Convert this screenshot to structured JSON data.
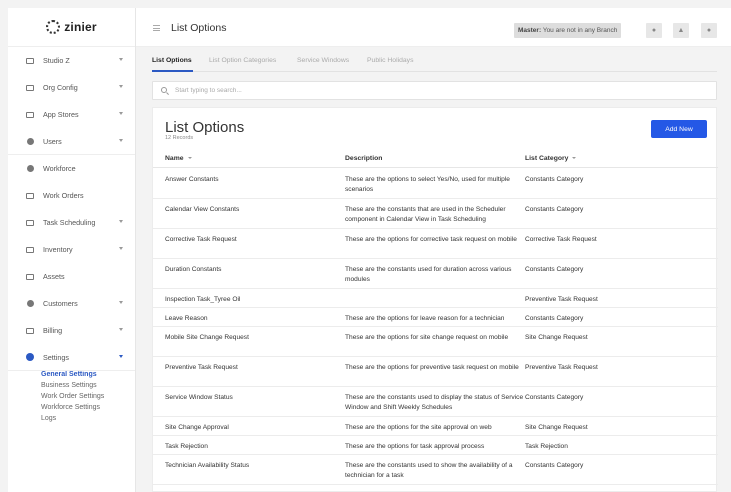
{
  "app": {
    "logo_text": "zinier",
    "page_title": "List Options"
  },
  "sidebar": {
    "items": [
      {
        "label": "Studio Z",
        "icon": "studio-icon",
        "caret": true
      },
      {
        "label": "Org Config",
        "icon": "org-config-icon",
        "caret": true
      },
      {
        "label": "App Stores",
        "icon": "store-icon",
        "caret": true
      },
      {
        "label": "Users",
        "icon": "users-icon",
        "caret": true
      },
      {
        "label": "Workforce",
        "icon": "workforce-icon",
        "caret": false
      },
      {
        "label": "Work Orders",
        "icon": "work-orders-icon",
        "caret": false
      },
      {
        "label": "Task Scheduling",
        "icon": "truck-icon",
        "caret": true
      },
      {
        "label": "Inventory",
        "icon": "inventory-icon",
        "caret": true
      },
      {
        "label": "Assets",
        "icon": "assets-icon",
        "caret": false
      },
      {
        "label": "Customers",
        "icon": "customers-icon",
        "caret": true
      },
      {
        "label": "Billing",
        "icon": "billing-icon",
        "caret": true
      },
      {
        "label": "Settings",
        "icon": "gear-icon",
        "caret": true
      }
    ],
    "settings_sub": [
      "General Settings",
      "Business Settings",
      "Work Order Settings",
      "Workforce Settings",
      "Logs"
    ]
  },
  "topbar": {
    "branch_label": "Master:",
    "branch_text": "You are not in any Branch"
  },
  "tabs": [
    "List Options",
    "List Option Categories",
    "Service Windows",
    "Public Holidays"
  ],
  "search": {
    "placeholder": "Start typing to search..."
  },
  "card": {
    "title": "List Options",
    "record_count": "12 Records",
    "add_button": "Add New"
  },
  "table": {
    "headers": [
      "Name",
      "Description",
      "List Category"
    ],
    "rows": [
      [
        "Answer Constants",
        "These are the options to select Yes/No, used for multiple scenarios",
        "Constants Category"
      ],
      [
        "Calendar View Constants",
        "These are the constants that are used in the Scheduler component in Calendar View in Task Scheduling",
        "Constants Category"
      ],
      [
        "Corrective Task Request",
        "These are the options for corrective task request on mobile",
        "Corrective Task Request"
      ],
      [
        "Duration Constants",
        "These are the constants used for duration across various modules",
        "Constants Category"
      ],
      [
        "Inspection Task_Tyree Oil",
        "",
        "Preventive Task Request"
      ],
      [
        "Leave Reason",
        "These are the options for leave reason for a technician",
        "Constants Category"
      ],
      [
        "Mobile Site Change Request",
        "These are the options for site change request on mobile",
        "Site Change Request"
      ],
      [
        "Preventive Task Request",
        "These are the options for preventive task request on mobile",
        "Preventive Task Request"
      ],
      [
        "Service Window Status",
        "These are the constants used to display the status of Service Window and Shift Weekly Schedules",
        "Constants Category"
      ],
      [
        "Site Change Approval",
        "These are the options for the site approval on web",
        "Site Change Request"
      ],
      [
        "Task Rejection",
        "These are the options for task approval process",
        "Task Rejection"
      ],
      [
        "Technician Availability Status",
        "These are the constants used to show the availability of a technician for a task",
        "Constants Category"
      ]
    ]
  },
  "colors": {
    "accent": "#2458e6",
    "active_link": "#2b59c3"
  }
}
